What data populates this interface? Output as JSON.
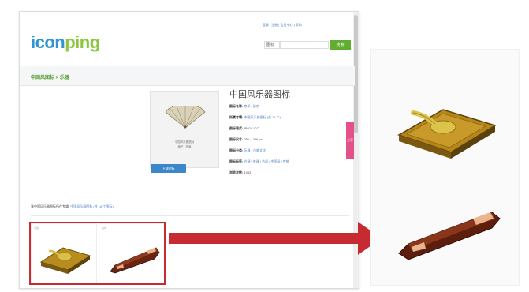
{
  "site": {
    "logo_main": "icon",
    "logo_accent": "ping",
    "top_links": "登录 | 注册 | 会员中心 | 帮助",
    "search_scope": "图标",
    "search_button": "搜索"
  },
  "breadcrumb": "中国风图标 > 乐器",
  "detail": {
    "title": "中国风乐器图标",
    "preview_caption_1": "中国风乐器图标",
    "preview_caption_2": "扇子 · 折扇",
    "download_button": "下载图标",
    "rows": [
      {
        "label": "图标名称:",
        "value": "扇子 · 折扇"
      },
      {
        "label": "所属专辑:",
        "value": "中国风乐器图标 (共 16 个)"
      },
      {
        "label": "图标格式:",
        "value": "PNG / ICO"
      },
      {
        "label": "图标尺寸:",
        "value": "256 × 256 px"
      },
      {
        "label": "图标分类:",
        "value": "乐器 · 古典文化"
      },
      {
        "label": "图标标签:",
        "value": "古琴 / 茶具 / 古风 / 中国风 / 传统"
      },
      {
        "label": "浏览次数:",
        "value": "1043"
      }
    ],
    "side_tab": "分享"
  },
  "related": {
    "title_prefix": "该中国风乐器图标所在专辑:",
    "title_link": "中国风乐器图标 (共 16 个图标)",
    "thumb_1_tag": "茶盘",
    "thumb_2_tag": "古琴"
  },
  "colors": {
    "brand_blue": "#2e94d2",
    "brand_green": "#8cc63f",
    "highlight_red": "#c62b31"
  }
}
